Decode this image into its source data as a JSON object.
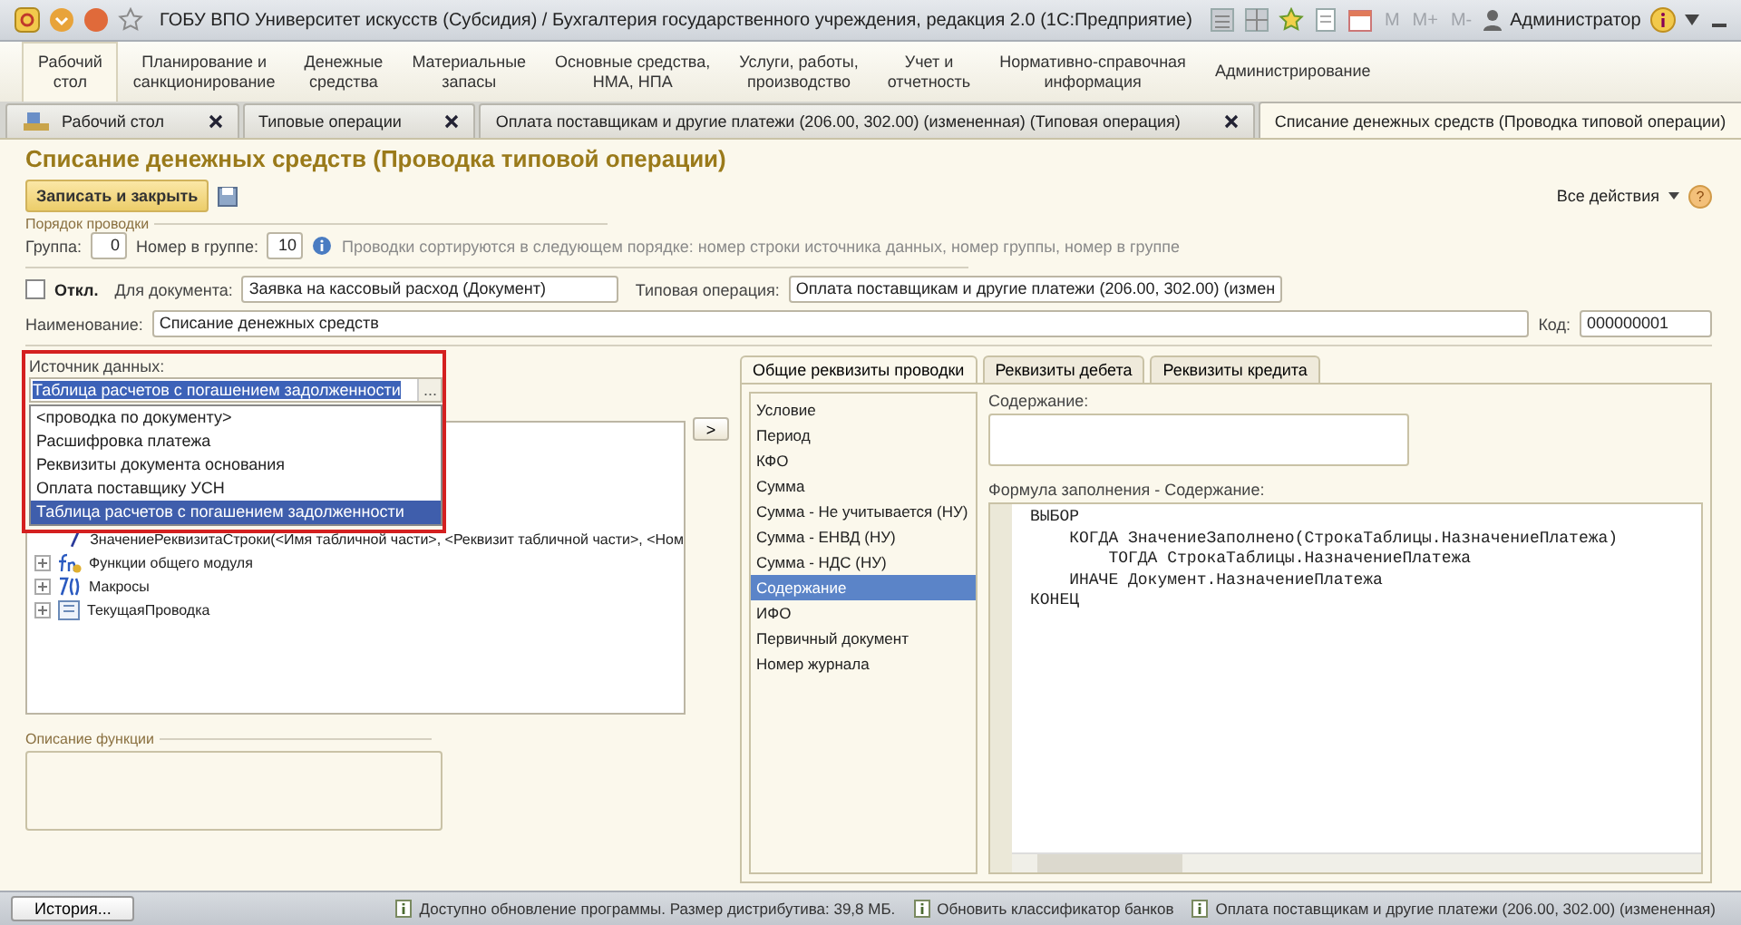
{
  "window": {
    "title": "ГОБУ ВПО Университет искусств (Субсидия) / Бухгалтерия государственного учреждения, редакция 2.0  (1С:Предприятие)",
    "memory_buttons": [
      "M",
      "M+",
      "M-"
    ],
    "user": "Администратор"
  },
  "sections": [
    {
      "label": "Рабочий\nстол",
      "selected": true
    },
    {
      "label": "Планирование и\nсанкционирование",
      "selected": false
    },
    {
      "label": "Денежные\nсредства",
      "selected": false
    },
    {
      "label": "Материальные\nзапасы",
      "selected": false
    },
    {
      "label": "Основные средства,\nНМА, НПА",
      "selected": false
    },
    {
      "label": "Услуги, работы,\nпроизводство",
      "selected": false
    },
    {
      "label": "Учет и\nотчетность",
      "selected": false
    },
    {
      "label": "Нормативно-справочная\nинформация",
      "selected": false
    },
    {
      "label": "Администрирование",
      "selected": false
    }
  ],
  "tabs": [
    {
      "label": "Рабочий стол",
      "kind": "desktop",
      "selected": false
    },
    {
      "label": "Типовые операции",
      "kind": "document",
      "selected": false
    },
    {
      "label": "Оплата поставщикам и другие платежи (206.00, 302.00) (измененная) (Типовая операция)",
      "kind": "document",
      "selected": false
    },
    {
      "label": "Списание денежных средств (Проводка типовой операции)",
      "kind": "document",
      "selected": true
    }
  ],
  "form": {
    "heading": "Списание денежных средств (Проводка типовой операции)",
    "save_button": "Записать и закрыть",
    "all_actions": "Все действия",
    "help_button": "?",
    "posting_order": {
      "legend": "Порядок проводки",
      "group_label": "Группа:",
      "group_value": "0",
      "number_label": "Номер в группе:",
      "number_value": "10",
      "hint": "Проводки сортируются в следующем порядке: номер строки источника данных, номер группы,  номер в группе"
    },
    "disabled": {
      "label": "Откл.",
      "checked": false
    },
    "document": {
      "label": "Для документа:",
      "value": "Заявка на кассовый расход (Документ)"
    },
    "operation": {
      "label": "Типовая операция:",
      "value": "Оплата поставщикам и другие платежи (206.00, 302.00) (измен"
    },
    "name": {
      "label": "Наименование:",
      "value": "Списание денежных средств"
    },
    "code": {
      "label": "Код:",
      "value": "000000001"
    }
  },
  "data_source": {
    "label": "Источник данных:",
    "value": "Таблица расчетов с погашением задолженности",
    "choose_button": "...",
    "options": [
      {
        "label": "<проводка по документу>",
        "selected": false
      },
      {
        "label": "Расшифровка платежа",
        "selected": false
      },
      {
        "label": "Реквизиты документа основания",
        "selected": false
      },
      {
        "label": "Оплата поставщику УСН",
        "selected": false
      },
      {
        "label": "Таблица расчетов с погашением задолженности",
        "selected": true
      }
    ]
  },
  "tree": [
    {
      "label": "ЗначениеРеквизитаСтроки(<Имя табличной части>, <Реквизит табличной части>, <Ном",
      "kind": "function",
      "expandable": false
    },
    {
      "label": "Функции общего модуля",
      "kind": "module",
      "expandable": true
    },
    {
      "label": "Макросы",
      "kind": "macros",
      "expandable": true
    },
    {
      "label": "ТекущаяПроводка",
      "kind": "posting",
      "expandable": true
    }
  ],
  "move_button": ">",
  "function_description": {
    "legend": "Описание функции"
  },
  "detail_tabs": [
    {
      "label": "Общие реквизиты проводки",
      "selected": true
    },
    {
      "label": "Реквизиты дебета",
      "selected": false
    },
    {
      "label": "Реквизиты кредита",
      "selected": false
    }
  ],
  "requisites": [
    {
      "label": "Условие",
      "selected": false
    },
    {
      "label": "Период",
      "selected": false
    },
    {
      "label": "КФО",
      "selected": false
    },
    {
      "label": "Сумма",
      "selected": false
    },
    {
      "label": "Сумма - Не учитывается (НУ)",
      "selected": false
    },
    {
      "label": "Сумма - ЕНВД (НУ)",
      "selected": false
    },
    {
      "label": "Сумма - НДС (НУ)",
      "selected": false
    },
    {
      "label": "Содержание",
      "selected": true
    },
    {
      "label": "ИФО",
      "selected": false
    },
    {
      "label": "Первичный документ",
      "selected": false
    },
    {
      "label": "Номер журнала",
      "selected": false
    }
  ],
  "content": {
    "label": "Содержание:"
  },
  "formula": {
    "label": "Формула заполнения - Содержание:",
    "lines": [
      "ВЫБОР",
      "    КОГДА ЗначениеЗаполнено(СтрокаТаблицы.НазначениеПлатежа)",
      "        ТОГДА СтрокаТаблицы.НазначениеПлатежа",
      "    ИНАЧЕ Документ.НазначениеПлатежа",
      "КОНЕЦ"
    ]
  },
  "status_bar": {
    "history_button": "История...",
    "notices": [
      "Доступно обновление программы. Размер дистрибутива: 39,8 МБ.",
      "Обновить классификатор банков",
      "Оплата поставщикам и другие платежи (206.00, 302.00) (измененная)"
    ]
  }
}
